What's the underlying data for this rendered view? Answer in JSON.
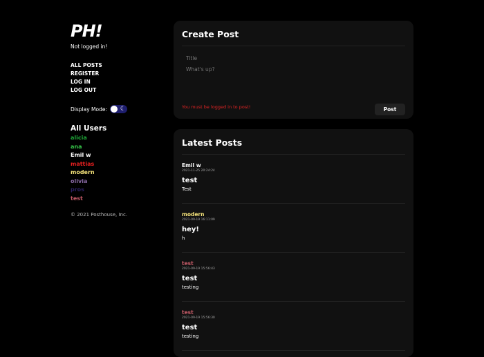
{
  "logo": "PH!",
  "login_status": "Not logged in!",
  "nav": [
    "ALL POSTS",
    "REGISTER",
    "LOG IN",
    "LOG OUT"
  ],
  "display_mode": {
    "label": "Display Mode:",
    "value": "dark"
  },
  "users_title": "All Users",
  "users": [
    {
      "name": "alicia",
      "color": "#1fa838"
    },
    {
      "name": "ana",
      "color": "#37c84a"
    },
    {
      "name": "Emil w",
      "color": "#ffffff"
    },
    {
      "name": "mattias",
      "color": "#e82020"
    },
    {
      "name": "modern",
      "color": "#f4e27a"
    },
    {
      "name": "olivia",
      "color": "#8a6aa6"
    },
    {
      "name": "pros",
      "color": "#2a1f5e"
    },
    {
      "name": "test",
      "color": "#c25a66"
    }
  ],
  "copyright": "© 2021 Posthouse, Inc.",
  "create_post": {
    "title": "Create Post",
    "title_placeholder": "Title",
    "body_placeholder": "What's up?",
    "error": "You must be logged in to post!",
    "button": "Post"
  },
  "latest_posts": {
    "title": "Latest Posts",
    "posts": [
      {
        "author": "Emil w",
        "author_color": "#ffffff",
        "date": "2021-11-25 20:24:24",
        "title": "test",
        "body": "Test"
      },
      {
        "author": "modern",
        "author_color": "#f4e27a",
        "date": "2021-09-19 16:11:09",
        "title": "hey!",
        "body": "h"
      },
      {
        "author": "test",
        "author_color": "#c25a66",
        "date": "2021-09-19 15:56:43",
        "title": "test",
        "body": "testing"
      },
      {
        "author": "test",
        "author_color": "#c25a66",
        "date": "2021-09-19 15:56:30",
        "title": "test",
        "body": "testing"
      }
    ]
  }
}
